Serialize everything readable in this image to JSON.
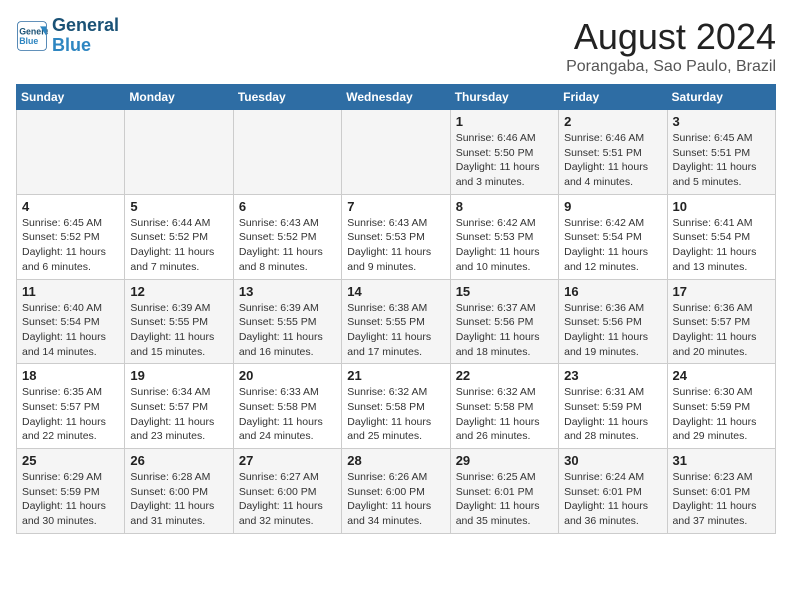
{
  "logo": {
    "line1": "General",
    "line2": "Blue"
  },
  "title": "August 2024",
  "location": "Porangaba, Sao Paulo, Brazil",
  "days_header": [
    "Sunday",
    "Monday",
    "Tuesday",
    "Wednesday",
    "Thursday",
    "Friday",
    "Saturday"
  ],
  "weeks": [
    [
      {
        "day": "",
        "info": ""
      },
      {
        "day": "",
        "info": ""
      },
      {
        "day": "",
        "info": ""
      },
      {
        "day": "",
        "info": ""
      },
      {
        "day": "1",
        "info": "Sunrise: 6:46 AM\nSunset: 5:50 PM\nDaylight: 11 hours\nand 3 minutes."
      },
      {
        "day": "2",
        "info": "Sunrise: 6:46 AM\nSunset: 5:51 PM\nDaylight: 11 hours\nand 4 minutes."
      },
      {
        "day": "3",
        "info": "Sunrise: 6:45 AM\nSunset: 5:51 PM\nDaylight: 11 hours\nand 5 minutes."
      }
    ],
    [
      {
        "day": "4",
        "info": "Sunrise: 6:45 AM\nSunset: 5:52 PM\nDaylight: 11 hours\nand 6 minutes."
      },
      {
        "day": "5",
        "info": "Sunrise: 6:44 AM\nSunset: 5:52 PM\nDaylight: 11 hours\nand 7 minutes."
      },
      {
        "day": "6",
        "info": "Sunrise: 6:43 AM\nSunset: 5:52 PM\nDaylight: 11 hours\nand 8 minutes."
      },
      {
        "day": "7",
        "info": "Sunrise: 6:43 AM\nSunset: 5:53 PM\nDaylight: 11 hours\nand 9 minutes."
      },
      {
        "day": "8",
        "info": "Sunrise: 6:42 AM\nSunset: 5:53 PM\nDaylight: 11 hours\nand 10 minutes."
      },
      {
        "day": "9",
        "info": "Sunrise: 6:42 AM\nSunset: 5:54 PM\nDaylight: 11 hours\nand 12 minutes."
      },
      {
        "day": "10",
        "info": "Sunrise: 6:41 AM\nSunset: 5:54 PM\nDaylight: 11 hours\nand 13 minutes."
      }
    ],
    [
      {
        "day": "11",
        "info": "Sunrise: 6:40 AM\nSunset: 5:54 PM\nDaylight: 11 hours\nand 14 minutes."
      },
      {
        "day": "12",
        "info": "Sunrise: 6:39 AM\nSunset: 5:55 PM\nDaylight: 11 hours\nand 15 minutes."
      },
      {
        "day": "13",
        "info": "Sunrise: 6:39 AM\nSunset: 5:55 PM\nDaylight: 11 hours\nand 16 minutes."
      },
      {
        "day": "14",
        "info": "Sunrise: 6:38 AM\nSunset: 5:55 PM\nDaylight: 11 hours\nand 17 minutes."
      },
      {
        "day": "15",
        "info": "Sunrise: 6:37 AM\nSunset: 5:56 PM\nDaylight: 11 hours\nand 18 minutes."
      },
      {
        "day": "16",
        "info": "Sunrise: 6:36 AM\nSunset: 5:56 PM\nDaylight: 11 hours\nand 19 minutes."
      },
      {
        "day": "17",
        "info": "Sunrise: 6:36 AM\nSunset: 5:57 PM\nDaylight: 11 hours\nand 20 minutes."
      }
    ],
    [
      {
        "day": "18",
        "info": "Sunrise: 6:35 AM\nSunset: 5:57 PM\nDaylight: 11 hours\nand 22 minutes."
      },
      {
        "day": "19",
        "info": "Sunrise: 6:34 AM\nSunset: 5:57 PM\nDaylight: 11 hours\nand 23 minutes."
      },
      {
        "day": "20",
        "info": "Sunrise: 6:33 AM\nSunset: 5:58 PM\nDaylight: 11 hours\nand 24 minutes."
      },
      {
        "day": "21",
        "info": "Sunrise: 6:32 AM\nSunset: 5:58 PM\nDaylight: 11 hours\nand 25 minutes."
      },
      {
        "day": "22",
        "info": "Sunrise: 6:32 AM\nSunset: 5:58 PM\nDaylight: 11 hours\nand 26 minutes."
      },
      {
        "day": "23",
        "info": "Sunrise: 6:31 AM\nSunset: 5:59 PM\nDaylight: 11 hours\nand 28 minutes."
      },
      {
        "day": "24",
        "info": "Sunrise: 6:30 AM\nSunset: 5:59 PM\nDaylight: 11 hours\nand 29 minutes."
      }
    ],
    [
      {
        "day": "25",
        "info": "Sunrise: 6:29 AM\nSunset: 5:59 PM\nDaylight: 11 hours\nand 30 minutes."
      },
      {
        "day": "26",
        "info": "Sunrise: 6:28 AM\nSunset: 6:00 PM\nDaylight: 11 hours\nand 31 minutes."
      },
      {
        "day": "27",
        "info": "Sunrise: 6:27 AM\nSunset: 6:00 PM\nDaylight: 11 hours\nand 32 minutes."
      },
      {
        "day": "28",
        "info": "Sunrise: 6:26 AM\nSunset: 6:00 PM\nDaylight: 11 hours\nand 34 minutes."
      },
      {
        "day": "29",
        "info": "Sunrise: 6:25 AM\nSunset: 6:01 PM\nDaylight: 11 hours\nand 35 minutes."
      },
      {
        "day": "30",
        "info": "Sunrise: 6:24 AM\nSunset: 6:01 PM\nDaylight: 11 hours\nand 36 minutes."
      },
      {
        "day": "31",
        "info": "Sunrise: 6:23 AM\nSunset: 6:01 PM\nDaylight: 11 hours\nand 37 minutes."
      }
    ]
  ]
}
